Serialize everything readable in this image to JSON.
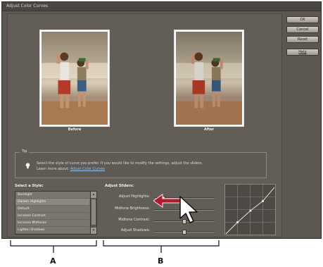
{
  "window": {
    "title": "Adjust Color Curves"
  },
  "preview": {
    "before_label": "Before",
    "after_label": "After"
  },
  "buttons": {
    "ok": "OK",
    "cancel": "Cancel",
    "reset": "Reset",
    "help": "Help"
  },
  "tip": {
    "label": "Tip",
    "text": "Select the style of curve you prefer. If you would like to modify the settings, adjust the sliders.",
    "learn_prefix": "Learn more about:",
    "learn_link": "Adjust Color Curves"
  },
  "styles": {
    "label": "Select a Style:",
    "items": [
      "Backlight",
      "Darken Highlights",
      "Default",
      "Increase Contrast",
      "Increase Midtones",
      "Lighten Shadows"
    ],
    "selected": "Darken Highlights"
  },
  "sliders": {
    "label": "Adjust Sliders:",
    "items": [
      {
        "label": "Adjust Highlights:",
        "value": 0.12
      },
      {
        "label": "Midtone Brightness:",
        "value": 0.5
      },
      {
        "label": "Midtone Contrast:",
        "value": 0.5
      },
      {
        "label": "Adjust Shadows:",
        "value": 0.5
      }
    ]
  },
  "callouts": {
    "a": "A",
    "b": "B"
  },
  "colors": {
    "dialog_bg": "#5c5751",
    "arrow": "#b01c2e",
    "link": "#8ac4f0"
  }
}
